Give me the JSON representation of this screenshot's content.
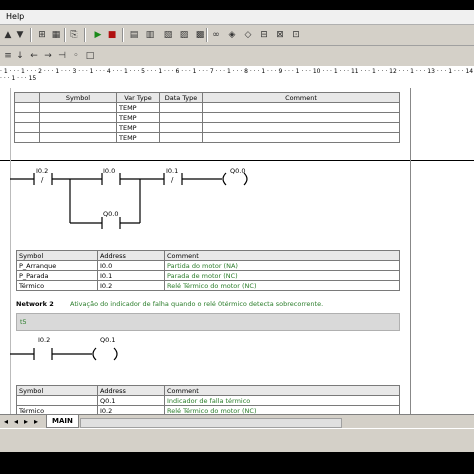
{
  "menu": {
    "help": "Help"
  },
  "vartable": {
    "headers": [
      "Symbol",
      "Var Type",
      "Data Type",
      "Comment"
    ],
    "rows": [
      "TEMP",
      "TEMP",
      "TEMP",
      "TEMP"
    ]
  },
  "network1": {
    "contacts": {
      "c1": "I0.2",
      "c2": "I0.0",
      "c3": "I0.1",
      "c4": "Q0.0",
      "coil": "Q0.0"
    },
    "symbols": {
      "headers": [
        "Symbol",
        "Address",
        "Comment"
      ],
      "rows": [
        {
          "symbol": "P_Arranque",
          "address": "I0.0",
          "comment": "Partida do motor (NA)"
        },
        {
          "symbol": "P_Parada",
          "address": "I0.1",
          "comment": "Parada de motor (NC)"
        },
        {
          "symbol": "Térmico",
          "address": "I0.2",
          "comment": "Relé Térmico do motor (NC)"
        }
      ]
    }
  },
  "network2": {
    "title": "Network 2",
    "description": "Ativação do indicador de falha quando o relé 0térmico detecta sobrecorrente.",
    "comment_text": "t5",
    "contacts": {
      "c1": "I0.2",
      "coil": "Q0.1"
    },
    "symbols": {
      "headers": [
        "Symbol",
        "Address",
        "Comment"
      ],
      "rows": [
        {
          "symbol": "",
          "address": "Q0.1",
          "comment": "Indicador de falla térmico"
        },
        {
          "symbol": "Térmico",
          "address": "I0.2",
          "comment": "Relé Térmico do motor (NC)"
        }
      ]
    }
  },
  "tabs": {
    "main": "MAIN"
  },
  "ruler": {
    "marks": "· 1 · · · 1 · · · 2 · · · 1 · · · 3 · · · 1 · · · 4 · · · 1 · · · 5 · · · 1 · · · 6 · · · 1 · · · 7 · · · 1 · · · 8 · · · 1 · · · 9 · · · 1 · · · 10 · · · 1 · · · 11 · · · 1 · · · 12 · · · 1 · · · 13 · · · 1 · · · 14 · · · 1 · · · 15"
  },
  "contact_slash": "/",
  "coil_glyph": "( )"
}
